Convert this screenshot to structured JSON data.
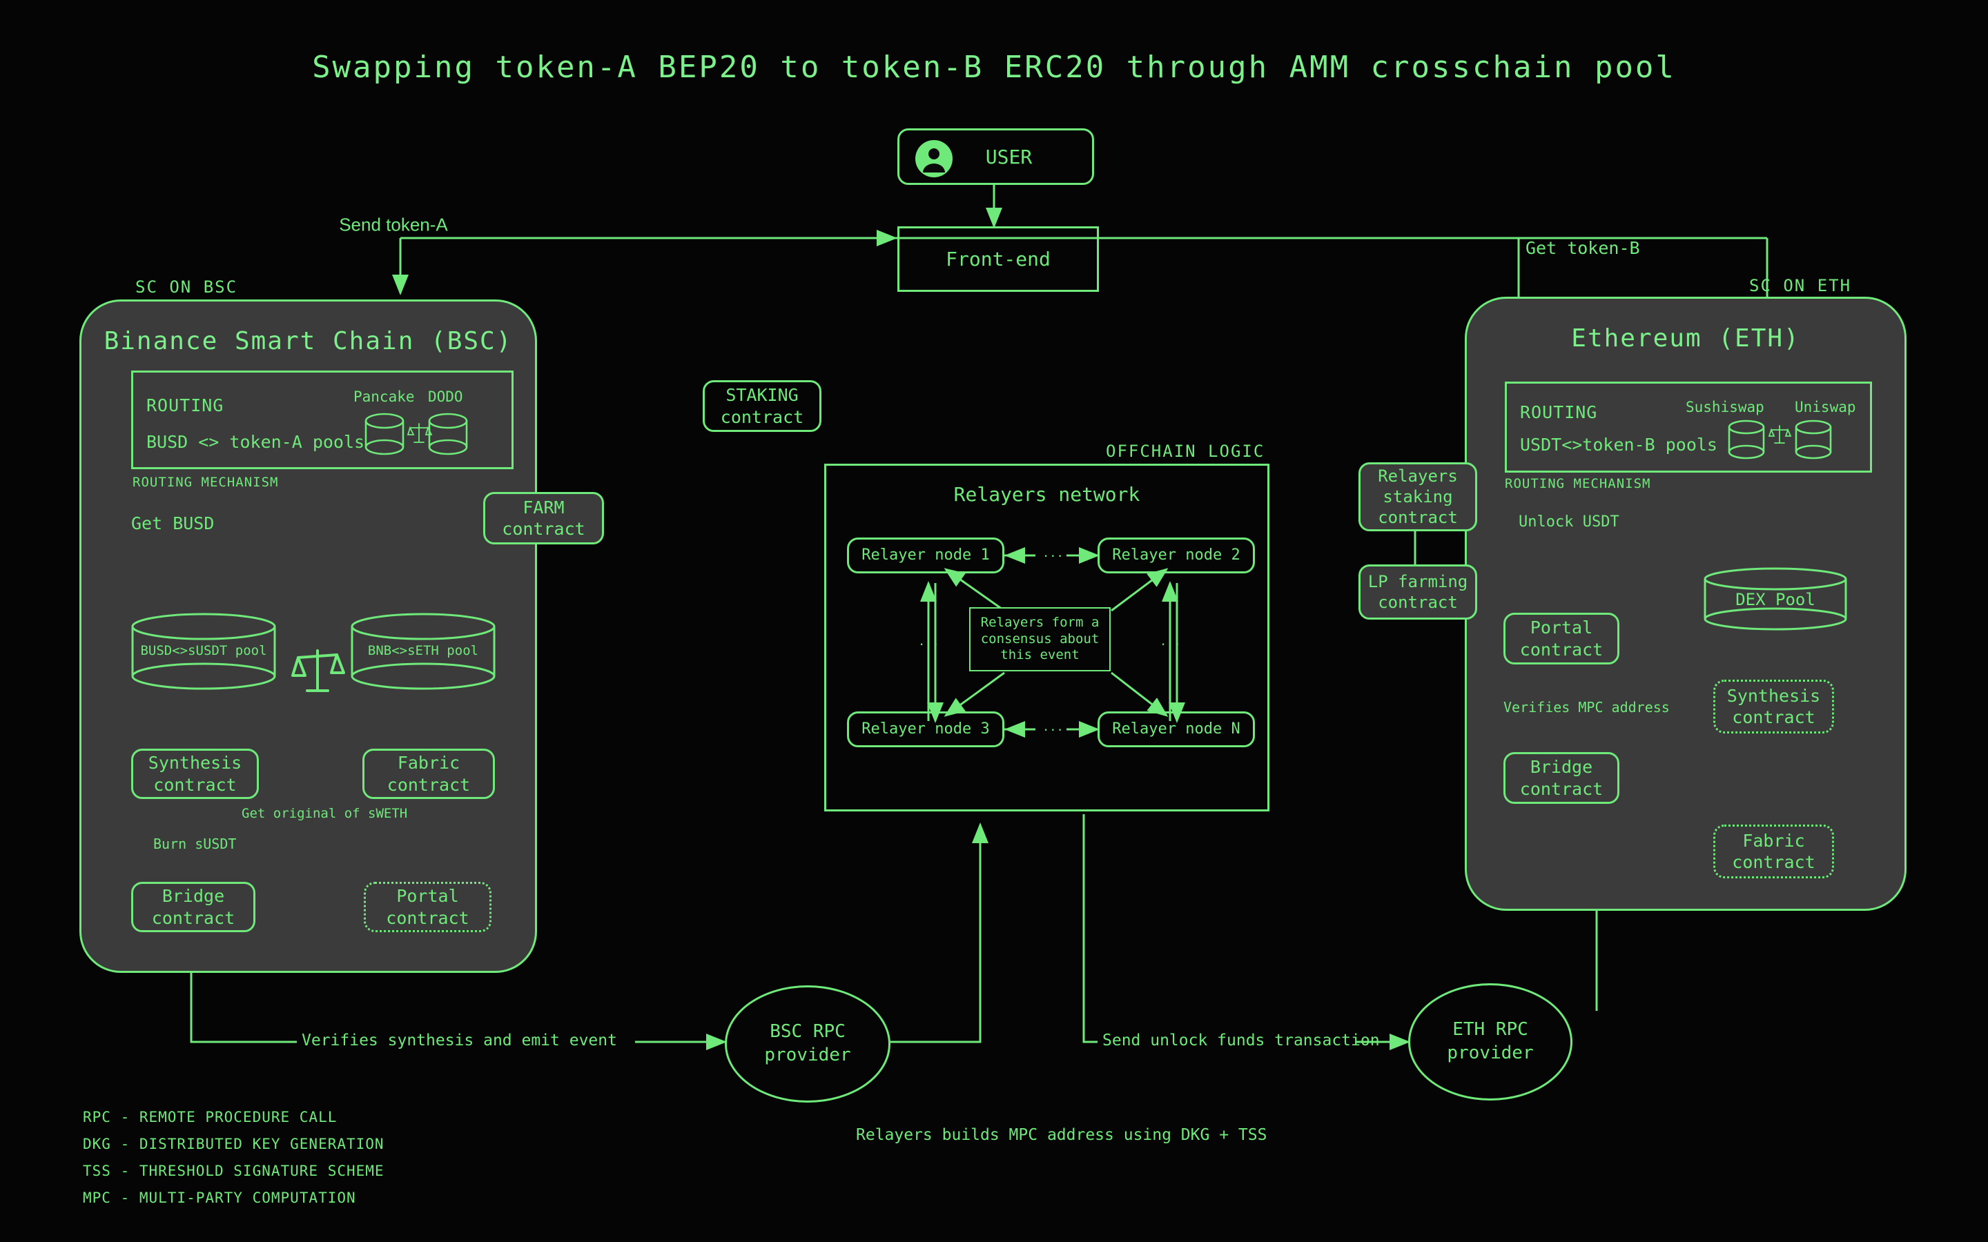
{
  "title": "Swapping token-A BEP20 to token-B ERC20 through AMM crosschain pool",
  "user": {
    "label": "USER",
    "icon": "user-avatar-icon"
  },
  "frontend": {
    "label": "Front-end"
  },
  "flow_labels": {
    "send_token_a": "Send token-A",
    "get_token_b": "Get token-B",
    "get_busd": "Get BUSD",
    "burn_susdt": "Burn sUSDT",
    "get_original_sweth": "Get original of sWETH",
    "unlock_usdt": "Unlock USDT",
    "verifies_mpc": "Verifies MPC address",
    "verifies_synthesis": "Verifies synthesis and emit event",
    "send_unlock_funds": "Send unlock funds transaction",
    "relayers_mpc_note": "Relayers builds MPC address using DKG + TSS"
  },
  "bsc": {
    "tag": "SC ON BSC",
    "title": "Binance Smart Chain (BSC)",
    "routing": {
      "heading": "ROUTING",
      "pools_label": "BUSD <> token-A pools",
      "mechanism": "ROUTING MECHANISM",
      "dex": [
        {
          "name": "Pancake",
          "icon": "cylinder-pool-icon"
        },
        {
          "name": "DODO",
          "icon": "cylinder-pool-icon"
        }
      ],
      "balance_icon": "scales-balance-icon"
    },
    "pools": [
      {
        "label": "BUSD<>sUSDT pool",
        "icon": "cylinder-pool-icon"
      },
      {
        "label": "BNB<>sETH pool",
        "icon": "cylinder-pool-icon"
      }
    ],
    "balance_icon": "scales-balance-icon",
    "contracts": [
      {
        "label": "Synthesis\ncontract",
        "style": "solid"
      },
      {
        "label": "Fabric\ncontract",
        "style": "solid"
      },
      {
        "label": "Bridge\ncontract",
        "style": "solid"
      },
      {
        "label": "Portal\ncontract",
        "style": "dotted"
      }
    ]
  },
  "eth": {
    "tag": "SC ON ETH",
    "title": "Ethereum (ETH)",
    "routing": {
      "heading": "ROUTING",
      "pools_label": "USDT<>token-B pools",
      "mechanism": "ROUTING MECHANISM",
      "dex": [
        {
          "name": "Sushiswap",
          "icon": "cylinder-pool-icon"
        },
        {
          "name": "Uniswap",
          "icon": "cylinder-pool-icon"
        }
      ],
      "balance_icon": "scales-balance-icon"
    },
    "dex_pool": {
      "label": "DEX Pool",
      "icon": "cylinder-pool-icon"
    },
    "contracts": [
      {
        "label": "Portal\ncontract",
        "style": "solid"
      },
      {
        "label": "Bridge\ncontract",
        "style": "solid"
      },
      {
        "label": "Synthesis\ncontract",
        "style": "dotted"
      },
      {
        "label": "Fabric\ncontract",
        "style": "dotted"
      }
    ]
  },
  "side_contracts": {
    "staking": "STAKING\ncontract",
    "farm": "FARM\ncontract",
    "relayers_staking": "Relayers\nstaking\ncontract",
    "lp_farming": "LP farming\ncontract"
  },
  "offchain": {
    "tag": "OFFCHAIN LOGIC",
    "title": "Relayers network",
    "nodes": [
      "Relayer node 1",
      "Relayer node 2",
      "Relayer node 3",
      "Relayer node N"
    ],
    "ellipsis": "...",
    "consensus_note": "Relayers form a\nconsensus about\nthis event"
  },
  "rpc": {
    "bsc": "BSC RPC\nprovider",
    "eth": "ETH RPC\nprovider"
  },
  "legend": [
    "RPC - REMOTE PROCEDURE CALL",
    "DKG - DISTRIBUTED KEY GENERATION",
    "TSS - THRESHOLD SIGNATURE SCHEME",
    "MPC - MULTI-PARTY COMPUTATION"
  ],
  "colors": {
    "background": "#050505",
    "accent": "#6ee97a",
    "accent_bright": "#7cf08a",
    "panel_fill": "#3b3b3b"
  }
}
